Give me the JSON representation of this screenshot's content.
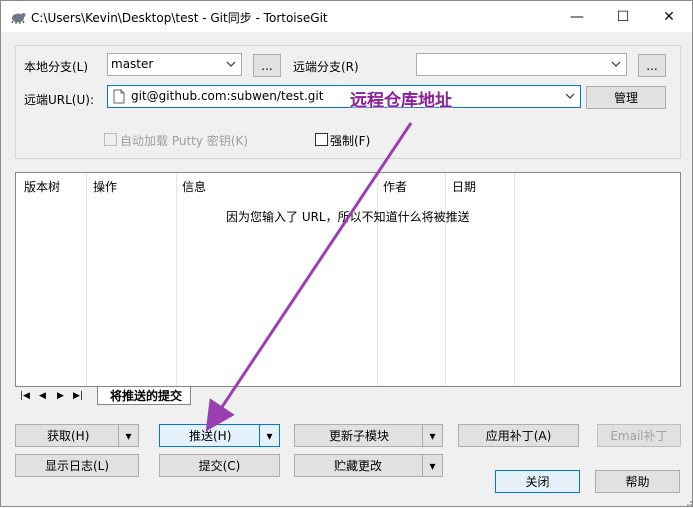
{
  "window": {
    "title": "C:\\Users\\Kevin\\Desktop\\test - Git同步 - TortoiseGit",
    "controls": {
      "minimize": "—",
      "maximize": "☐",
      "close": "✕"
    }
  },
  "branch_group": {
    "local_branch_label": "本地分支(L)",
    "local_branch_value": "master",
    "local_browse": "...",
    "remote_branch_label": "远端分支(R)",
    "remote_branch_value": "",
    "remote_browse": "...",
    "remote_url_label": "远端URL(U):",
    "remote_url_value": "git@github.com:subwen/test.git",
    "manage_button": "管理",
    "autoload_putty_label": "自动加载 Putty 密钥(K)",
    "force_label": "强制(F)"
  },
  "annotation": {
    "text": "远程仓库地址",
    "color": "#8b1e9a"
  },
  "list": {
    "columns": [
      "版本树",
      "操作",
      "信息",
      "作者",
      "日期"
    ],
    "empty_message": "因为您输入了 URL，所以不知道什么将被推送"
  },
  "tabs": {
    "nav": [
      "|◀",
      "◀",
      "▶",
      "▶|"
    ],
    "active": "将推送的提交"
  },
  "buttons": {
    "fetch": "获取(H)",
    "push": "推送(H)",
    "update_submodule": "更新子模块",
    "apply_patch": "应用补丁(A)",
    "email_patch": "Email补丁",
    "show_log": "显示日志(L)",
    "commit": "提交(C)",
    "stash": "贮藏更改",
    "close": "关闭",
    "help": "帮助"
  }
}
